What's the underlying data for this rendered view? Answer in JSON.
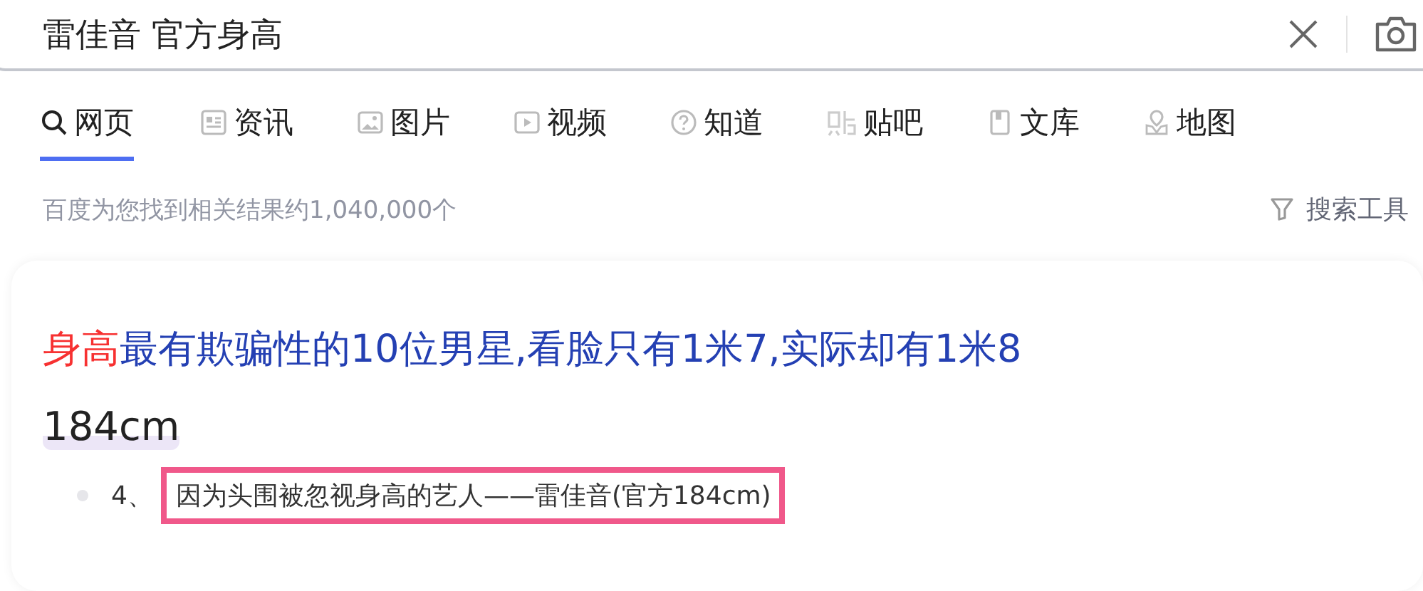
{
  "search": {
    "value": "雷佳音 官方身高"
  },
  "tabs": [
    {
      "label": "网页",
      "kind": "search",
      "selected": true
    },
    {
      "label": "资讯",
      "kind": "news",
      "selected": false
    },
    {
      "label": "图片",
      "kind": "image",
      "selected": false
    },
    {
      "label": "视频",
      "kind": "video",
      "selected": false
    },
    {
      "label": "知道",
      "kind": "question",
      "selected": false
    },
    {
      "label": "贴吧",
      "kind": "tieba",
      "selected": false
    },
    {
      "label": "文库",
      "kind": "doc",
      "selected": false
    },
    {
      "label": "地图",
      "kind": "map",
      "selected": false
    }
  ],
  "result_count": "百度为您找到相关结果约1,040,000个",
  "search_tools": "搜索工具",
  "result": {
    "title_highlight": "身高",
    "title_rest": "最有欺骗性的10位男星,看脸只有1米7,实际却有1米8",
    "subheading": "184cm",
    "list_item": {
      "number": "4、",
      "text": "因为头围被忽视身高的艺人——雷佳音(官方184cm)"
    }
  }
}
